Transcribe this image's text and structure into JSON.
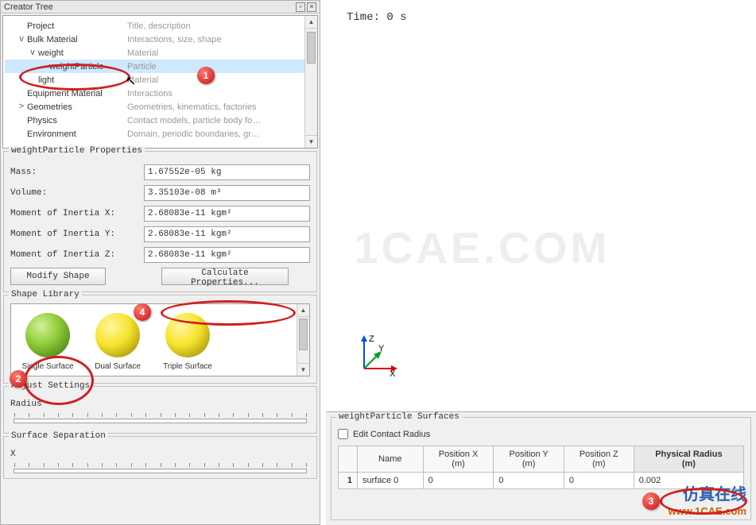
{
  "panel_title": "Creator Tree",
  "tree": [
    {
      "toggle": "",
      "label": "Project",
      "desc": "Title, description",
      "indent": 1
    },
    {
      "toggle": "v",
      "label": "Bulk Material",
      "desc": "Interactions, size, shape",
      "indent": 1
    },
    {
      "toggle": "v",
      "label": "weight",
      "desc": "Material",
      "indent": 2
    },
    {
      "toggle": "",
      "label": "weightParticle",
      "desc": "Particle",
      "indent": 3,
      "selected": true
    },
    {
      "toggle": "",
      "label": "light",
      "desc": "Material",
      "indent": 2
    },
    {
      "toggle": "",
      "label": "Equipment Material",
      "desc": "Interactions",
      "indent": 1
    },
    {
      "toggle": ">",
      "label": "Geometries",
      "desc": "Geometries, kinematics, factories",
      "indent": 1
    },
    {
      "toggle": "",
      "label": "Physics",
      "desc": "Contact models, particle body fo…",
      "indent": 1
    },
    {
      "toggle": "",
      "label": "Environment",
      "desc": "Domain, periodic boundaries, gr…",
      "indent": 1
    }
  ],
  "props": {
    "title": "weightParticle Properties",
    "rows": [
      {
        "label": "Mass:",
        "value": "1.67552e-05 kg"
      },
      {
        "label": "Volume:",
        "value": "3.35103e-08 m³"
      },
      {
        "label": "Moment of Inertia X:",
        "value": "2.68083e-11 kgm²"
      },
      {
        "label": "Moment of Inertia Y:",
        "value": "2.68083e-11 kgm²"
      },
      {
        "label": "Moment of Inertia Z:",
        "value": "2.68083e-11 kgm²"
      }
    ],
    "modify": "Modify Shape",
    "calc": "Calculate Properties..."
  },
  "shape": {
    "title": "Shape Library",
    "items": [
      "Single Surface",
      "Dual Surface",
      "Triple Surface"
    ]
  },
  "adjust": {
    "title": "Adjust Settings",
    "radius": "Radius"
  },
  "sep": {
    "title": "Surface Separation",
    "x": "X"
  },
  "viewport": {
    "time": "Time: 0 s",
    "axes": {
      "x": "X",
      "y": "Y",
      "z": "Z"
    },
    "watermark": "1CAE.COM"
  },
  "surfaces": {
    "title": "weightParticle Surfaces",
    "edit": "Edit Contact Radius",
    "headers": [
      "Name",
      "Position X\n(m)",
      "Position Y\n(m)",
      "Position Z\n(m)",
      "Physical Radius\n(m)"
    ],
    "row": {
      "num": "1",
      "name": "surface 0",
      "px": "0",
      "py": "0",
      "pz": "0",
      "pr": "0.002"
    }
  },
  "brand": {
    "line1": "仿真在线",
    "line2": "www.1CAE.com"
  },
  "chart_data": null
}
